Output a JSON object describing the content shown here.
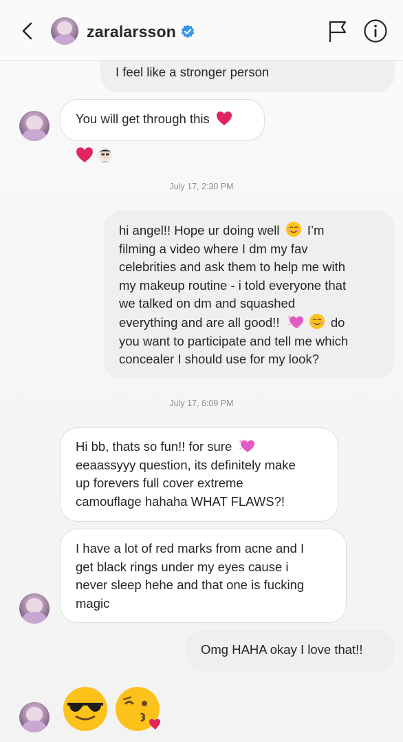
{
  "header": {
    "username": "zaralarsson",
    "verified": true,
    "icons": [
      "back-icon",
      "flag-icon",
      "info-icon",
      "verified-badge-icon"
    ]
  },
  "messages": {
    "m1": {
      "text": "I feel like a stronger person",
      "direction": "outgoing"
    },
    "m2": {
      "text": "You will get through this",
      "emoji": "red-heart",
      "direction": "incoming"
    },
    "m2_reactions": [
      "red-heart",
      "user-avatar"
    ],
    "ts1": "July 17, 2:30 PM",
    "m3": {
      "line1": "hi angel!! Hope ur doing well",
      "line1b": "I’m",
      "line2": "filming a video where I dm my fav",
      "line3": "celebrities and ask them to help me with",
      "line4": "my makeup routine - i told everyone that",
      "line5": "we talked on dm and squashed",
      "line6": "everything and are all good!!",
      "line6b": "do",
      "line7": "you want to participate and tell me which",
      "line8": "concealer I should use for my look?",
      "direction": "outgoing"
    },
    "ts2": "July 17, 6:09 PM",
    "m4": {
      "line1": "Hi bb, thats so fun!! for sure",
      "line2": "eeaassyyy question, its definitely make",
      "line3": "up forevers full cover extreme",
      "line4": "camouflage hahaha WHAT FLAWS?!",
      "direction": "incoming"
    },
    "m5": {
      "line1": "I have a lot of red marks from acne and I",
      "line2": "get black rings under my eyes cause i",
      "line3": "never sleep hehe and that one is fucking",
      "line4": "magic",
      "direction": "incoming"
    },
    "m6": {
      "text": "Omg HAHA okay I love that!!",
      "direction": "outgoing"
    },
    "m7": {
      "emojis": [
        "smiling-face-with-sunglasses",
        "face-blowing-a-kiss"
      ],
      "direction": "incoming"
    }
  },
  "colors": {
    "heart": "#e0245e",
    "verified": "#3897f0",
    "timestamp": "#8e8e8e"
  }
}
